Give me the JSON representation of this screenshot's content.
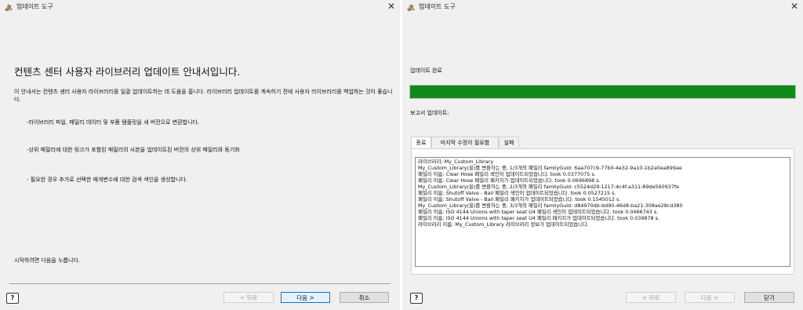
{
  "intro_window": {
    "title": "업데이트 도구",
    "heading": "컨텐츠 센터 사용자 라이브러리 업데이트 안내서입니다.",
    "intro_text": "이 안내서는 컨텐츠 센터 사용자 라이브러리를 일괄 업데이트하는 데 도움을 줍니다. 라이브러리 업데이트를 계속하기 전에 사용자 라이브러리를 백업하는 것이 좋습니다.",
    "bullets": [
      "-라이브러리 파일, 패밀리 데이터 및 부품 템플릿을 새 버전으로 변환합니다.",
      "-상위 패밀리에 대한 링크가 포함된 패밀리의 사본을 업데이트된 버전의 상위 패밀리와 동기화",
      "- 필요한 경우 추가로 선택한 매개변수에 대한 검색 색인을 생성합니다."
    ],
    "start_text": "시작하려면 다음을 누릅니다.",
    "buttons": {
      "help": "?",
      "back": "< 뒤로",
      "next": "다음 >",
      "cancel": "취소"
    }
  },
  "complete_window": {
    "title": "업데이트 도구",
    "status_label": "업데이트 완료",
    "progress_fraction": 1.0,
    "progress_color": "#0f8a1a",
    "report_label": "보고서 업데이트:",
    "tabs": [
      "종료",
      "마지막 수정이 필요함",
      "실패"
    ],
    "active_tab": "종료",
    "log_lines": [
      "라이브러리: My_Custom_Library",
      "My_Custom_Library(을)를 변환하는 중, 1/3개의 패밀리 familyGuid: 6aa707c9-77b0-4e32-9a10-1b2a0ea899ae",
      "패밀리 이름: Clear Hose 패밀리 색인이 업데이트되었습니다. took 0.0377075 s.",
      "패밀리 이름: Clear Hose 패밀리 패키지가 업데이트되었습니다. took 0.0696898 s.",
      "My_Custom_Library(을)를 변환하는 중, 2/3개의 패밀리 familyGuid: c5524d29-1217-4c4f-a311-89de560937fe",
      "패밀리 이름: Shutoff Valve - Ball 패밀리 색인이 업데이트되었습니다. took 0.0527215 s.",
      "패밀리 이름: Shutoff Valve - Ball 패밀리 패키지가 업데이트되었습니다. took 0.1545012 s.",
      "My_Custom_Library(을)를 변환하는 중, 3/3개의 패밀리 familyGuid: d84970db-bd90-46d8-ba21-308ae28cd380",
      "패밀리 이름: ISO 4144 Unions with taper seat U4 패밀리 색인이 업데이트되었습니다. took 0.0466743 s.",
      "패밀리 이름: ISO 4144 Unions with taper seat U4 패밀리 패키지가 업데이트되었습니다. took 0.039878 s.",
      "라이브러리 이름: My_Custom_Library 라이브러리 정보가 업데이트되었습니다."
    ],
    "buttons": {
      "help": "?",
      "back": "< 뒤로",
      "next": "다음 >",
      "close": "닫기"
    }
  },
  "icons": {
    "app": "app-icon",
    "close": "close-icon",
    "help": "help-icon"
  }
}
